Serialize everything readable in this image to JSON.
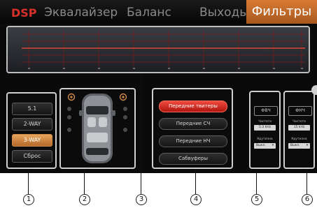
{
  "tabs": {
    "dsp": "DSP",
    "equalizer": "Эквалайзер",
    "balance": "Баланс",
    "outputs": "Выходы",
    "filters": "Фильтры"
  },
  "accent_color": "#d97b35",
  "mode_buttons": [
    "5.1",
    "2-WAY",
    "3-WAY",
    "Сброс"
  ],
  "active_mode": "3-WAY",
  "speaker_buttons": [
    "Передние твитеры",
    "Передние СЧ",
    "Передние НЧ",
    "Сабвуферы"
  ],
  "active_speaker": "Передние твитеры",
  "highpass_filter": {
    "title": "ФВЧ",
    "freq_label": "Частота",
    "freq_value": "5.3 kHz",
    "slope_label": "Крутизна",
    "slope_value": "Выкл."
  },
  "lowpass_filter": {
    "title": "ФНЧ",
    "freq_label": "Частота",
    "freq_value": "15 kHz",
    "slope_label": "Крутизна",
    "slope_value": "Выкл."
  },
  "callouts": [
    "1",
    "2",
    "3",
    "4",
    "5",
    "6"
  ]
}
